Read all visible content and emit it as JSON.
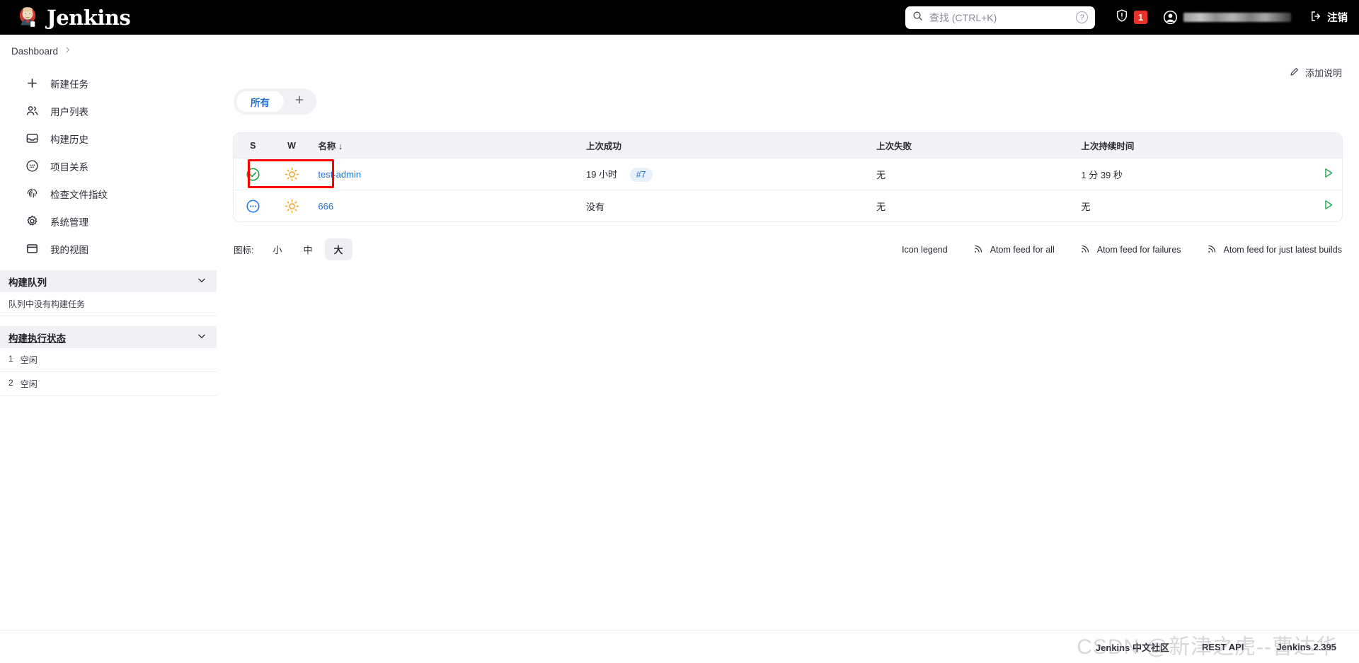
{
  "header": {
    "brand": "Jenkins",
    "brand_logo_icon": "jenkins-butler-icon",
    "search": {
      "placeholder": "查找 (CTRL+K)",
      "value": "",
      "icon": "search-icon",
      "help_icon": "help-circle-icon"
    },
    "security": {
      "icon": "shield-warning-icon",
      "count": "1"
    },
    "user": {
      "icon": "user-avatar-icon",
      "name_masked": ""
    },
    "logout": {
      "label": "注销",
      "icon": "logout-icon"
    }
  },
  "breadcrumb": {
    "items": [
      "Dashboard"
    ],
    "separator_icon": "chevron-right-icon"
  },
  "sidebar": {
    "items": [
      {
        "label": "新建任务",
        "icon": "plus-icon"
      },
      {
        "label": "用户列表",
        "icon": "people-icon"
      },
      {
        "label": "构建历史",
        "icon": "inbox-tray-icon"
      },
      {
        "label": "项目关系",
        "icon": "circle-dots-icon"
      },
      {
        "label": "检查文件指纹",
        "icon": "fingerprint-icon"
      },
      {
        "label": "系统管理",
        "icon": "gear-icon"
      },
      {
        "label": "我的视图",
        "icon": "window-icon"
      }
    ],
    "build_queue": {
      "title": "构建队列",
      "chevron_icon": "chevron-down-icon",
      "empty_text": "队列中没有构建任务"
    },
    "executors": {
      "title": "构建执行状态",
      "chevron_icon": "chevron-down-icon",
      "rows": [
        {
          "index": "1",
          "status": "空闲"
        },
        {
          "index": "2",
          "status": "空闲"
        }
      ]
    }
  },
  "main": {
    "add_description": {
      "label": "添加说明",
      "icon": "pencil-icon"
    },
    "tabs": [
      {
        "label": "所有",
        "active": true
      },
      {
        "label": "+",
        "active": false,
        "icon": "plus-icon"
      }
    ],
    "table": {
      "headers": [
        "S",
        "W",
        "名称 ↓",
        "上次成功",
        "上次失败",
        "上次持续时间",
        ""
      ],
      "rows": [
        {
          "status_icon": "status-success-icon",
          "weather_icon": "weather-sunny-icon",
          "name": "test-admin",
          "last_success": "19 小时",
          "last_success_build": "#7",
          "last_failure": "无",
          "last_duration": "1 分 39 秒",
          "run_icon": "play-icon",
          "highlighted": true
        },
        {
          "status_icon": "status-pending-icon",
          "weather_icon": "weather-sunny-icon",
          "name": "666",
          "last_success": "没有",
          "last_success_build": "",
          "last_failure": "无",
          "last_duration": "无",
          "run_icon": "play-icon",
          "highlighted": false
        }
      ]
    },
    "icon_size": {
      "label": "图标:",
      "options": [
        {
          "label": "小",
          "active": false
        },
        {
          "label": "中",
          "active": false
        },
        {
          "label": "大",
          "active": true
        }
      ]
    },
    "footer_links": [
      {
        "label": "Icon legend",
        "icon": ""
      },
      {
        "label": "Atom feed for all",
        "icon": "rss-icon"
      },
      {
        "label": "Atom feed for failures",
        "icon": "rss-icon"
      },
      {
        "label": "Atom feed for just latest builds",
        "icon": "rss-icon"
      }
    ]
  },
  "footer": {
    "items": [
      "Jenkins 中文社区",
      "REST API",
      "Jenkins 2.395"
    ],
    "watermark": "CSDN @新津之虎--曹达华"
  },
  "colors": {
    "accent_blue": "#1f6fd1",
    "success_green": "#1ea64b",
    "pending_blue": "#2b7ed8",
    "weather_orange": "#f5a623",
    "alert_red": "#e8332a",
    "annotation_red": "#ff0000",
    "header_black": "#000000"
  }
}
